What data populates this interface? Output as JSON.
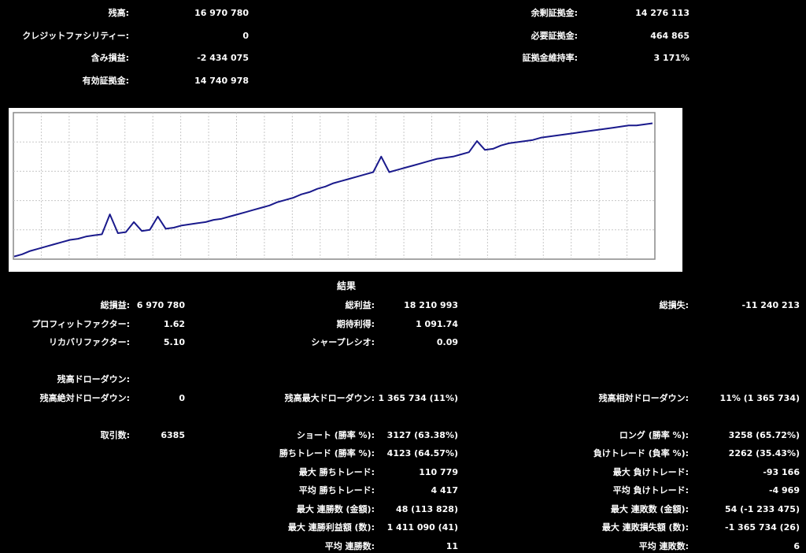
{
  "account": {
    "left": [
      {
        "label": "残高:",
        "value": "16 970 780"
      },
      {
        "label": "クレジットファシリティー:",
        "value": "0"
      },
      {
        "label": "含み損益:",
        "value": "-2 434 075"
      },
      {
        "label": "有効証拠金:",
        "value": "14 740 978"
      }
    ],
    "right": [
      {
        "label": "余剰証拠金:",
        "value": "14 276 113"
      },
      {
        "label": "必要証拠金:",
        "value": "464 865"
      },
      {
        "label": "証拠金維持率:",
        "value": "3 171%"
      }
    ]
  },
  "chart_data": {
    "type": "line",
    "title": "",
    "xlabel": "",
    "ylabel": "",
    "grid": true,
    "line_color": "#1a1a8c",
    "x": [
      0,
      1,
      2,
      3,
      4,
      5,
      6,
      7,
      8,
      9,
      10,
      11,
      12,
      13,
      14,
      15,
      16,
      17,
      18,
      19,
      20,
      21,
      22,
      23,
      24,
      25,
      26,
      27,
      28,
      29,
      30,
      31,
      32,
      33,
      34,
      35,
      36,
      37,
      38,
      39,
      40,
      41,
      42,
      43,
      44,
      45,
      46,
      47,
      48,
      49,
      50,
      51,
      52,
      53,
      54,
      55,
      56,
      57,
      58,
      59,
      60,
      61,
      62,
      63,
      64,
      65,
      66,
      67,
      68,
      69,
      70,
      71,
      72,
      73,
      74,
      75,
      76,
      77,
      78,
      79,
      80
    ],
    "values": [
      0.0,
      0.02,
      0.05,
      0.07,
      0.09,
      0.11,
      0.13,
      0.15,
      0.16,
      0.18,
      0.19,
      0.2,
      0.38,
      0.21,
      0.22,
      0.31,
      0.23,
      0.24,
      0.36,
      0.25,
      0.26,
      0.28,
      0.29,
      0.3,
      0.31,
      0.33,
      0.34,
      0.36,
      0.38,
      0.4,
      0.42,
      0.44,
      0.46,
      0.49,
      0.51,
      0.53,
      0.56,
      0.58,
      0.61,
      0.63,
      0.66,
      0.68,
      0.7,
      0.72,
      0.74,
      0.76,
      0.9,
      0.76,
      0.78,
      0.8,
      0.82,
      0.84,
      0.86,
      0.88,
      0.89,
      0.9,
      0.92,
      0.94,
      1.04,
      0.96,
      0.97,
      1.0,
      1.02,
      1.03,
      1.04,
      1.05,
      1.07,
      1.08,
      1.09,
      1.1,
      1.11,
      1.12,
      1.13,
      1.14,
      1.15,
      1.16,
      1.17,
      1.18,
      1.18,
      1.19,
      1.2
    ]
  },
  "results": {
    "title": "結果",
    "col1": [
      {
        "label": "総損益:",
        "value": "6 970 780"
      },
      {
        "label": "プロフィットファクター:",
        "value": "1.62"
      },
      {
        "label": "リカバリファクター:",
        "value": "5.10"
      },
      {
        "label": "",
        "value": ""
      },
      {
        "label": "残高ドローダウン:",
        "value": ""
      },
      {
        "label": "残高絶対ドローダウン:",
        "value": "0"
      },
      {
        "label": "",
        "value": ""
      },
      {
        "label": "取引数:",
        "value": "6385"
      }
    ],
    "col2": [
      {
        "label": "総利益:",
        "value": "18 210 993"
      },
      {
        "label": "期待利得:",
        "value": "1 091.74"
      },
      {
        "label": "シャープレシオ:",
        "value": "0.09"
      },
      {
        "label": "",
        "value": ""
      },
      {
        "label": "",
        "value": ""
      },
      {
        "label": "残高最大ドローダウン:",
        "value": "1 365 734 (11%)"
      },
      {
        "label": "",
        "value": ""
      },
      {
        "label": "ショート (勝率 %):",
        "value": "3127 (63.38%)"
      },
      {
        "label": "勝ちトレード (勝率 %):",
        "value": "4123 (64.57%)"
      },
      {
        "label": "最大 勝ちトレード:",
        "value": "110 779"
      },
      {
        "label": "平均 勝ちトレード:",
        "value": "4 417"
      },
      {
        "label": "最大 連勝数 (金額):",
        "value": "48 (113 828)"
      },
      {
        "label": "最大 連勝利益額 (数):",
        "value": "1 411 090 (41)"
      },
      {
        "label": "平均 連勝数:",
        "value": "11"
      }
    ],
    "col3": [
      {
        "label": "総損失:",
        "value": "-11 240 213"
      },
      {
        "label": "",
        "value": ""
      },
      {
        "label": "",
        "value": ""
      },
      {
        "label": "",
        "value": ""
      },
      {
        "label": "",
        "value": ""
      },
      {
        "label": "残高相対ドローダウン:",
        "value": "11% (1 365 734)"
      },
      {
        "label": "",
        "value": ""
      },
      {
        "label": "ロング (勝率 %):",
        "value": "3258 (65.72%)"
      },
      {
        "label": "負けトレード (負率 %):",
        "value": "2262 (35.43%)"
      },
      {
        "label": "最大 負けトレード:",
        "value": "-93 166"
      },
      {
        "label": "平均 負けトレード:",
        "value": "-4 969"
      },
      {
        "label": "最大 連敗数 (金額):",
        "value": "54 (-1 233 475)"
      },
      {
        "label": "最大 連敗損失額 (数):",
        "value": "-1 365 734 (26)"
      },
      {
        "label": "平均 連敗数:",
        "value": "6"
      }
    ]
  }
}
